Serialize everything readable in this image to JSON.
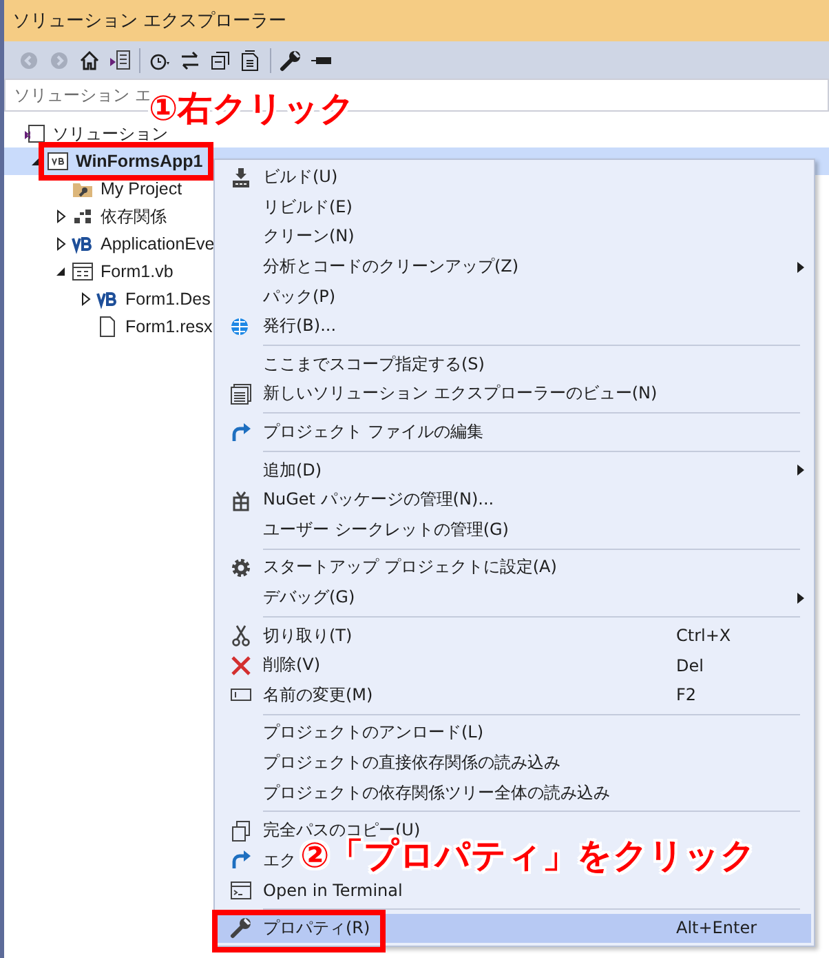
{
  "window": {
    "title": "ソリューション エクスプローラー"
  },
  "search": {
    "placeholder": "ソリューション エ"
  },
  "tree": [
    {
      "label": "ソリューション",
      "selected": false
    },
    {
      "label": "WinFormsApp1",
      "expanded": true,
      "selected": true,
      "children": [
        {
          "label": "My Project",
          "selected": false
        },
        {
          "label": "依存関係",
          "expanded": false,
          "selected": false
        },
        {
          "label": "ApplicationEve",
          "expanded": false,
          "selected": false
        },
        {
          "label": "Form1.vb",
          "expanded": true,
          "selected": false,
          "children": [
            {
              "label": "Form1.Des",
              "expanded": false,
              "selected": false
            },
            {
              "label": "Form1.resx",
              "selected": false
            }
          ]
        }
      ]
    }
  ],
  "context_menu": {
    "groups": [
      [
        {
          "label": "ビルド(U)",
          "submenu": false,
          "selected": false
        },
        {
          "label": "リビルド(E)",
          "submenu": false,
          "selected": false
        },
        {
          "label": "クリーン(N)",
          "submenu": false,
          "selected": false
        },
        {
          "label": "分析とコードのクリーンアップ(Z)",
          "submenu": true,
          "selected": false
        },
        {
          "label": "パック(P)",
          "submenu": false,
          "selected": false
        },
        {
          "label": "発行(B)...",
          "submenu": false,
          "selected": false
        }
      ],
      [
        {
          "label": "ここまでスコープ指定する(S)",
          "submenu": false,
          "selected": false
        },
        {
          "label": "新しいソリューション エクスプローラーのビュー(N)",
          "submenu": false,
          "selected": false
        }
      ],
      [
        {
          "label": "プロジェクト ファイルの編集",
          "submenu": false,
          "selected": false
        }
      ],
      [
        {
          "label": "追加(D)",
          "submenu": true,
          "selected": false
        },
        {
          "label": "NuGet パッケージの管理(N)...",
          "submenu": false,
          "selected": false
        },
        {
          "label": "ユーザー シークレットの管理(G)",
          "submenu": false,
          "selected": false
        }
      ],
      [
        {
          "label": "スタートアップ プロジェクトに設定(A)",
          "submenu": false,
          "selected": false
        },
        {
          "label": "デバッグ(G)",
          "submenu": true,
          "selected": false
        }
      ],
      [
        {
          "label": "切り取り(T)",
          "shortcut": "Ctrl+X",
          "submenu": false,
          "selected": false
        },
        {
          "label": "削除(V)",
          "shortcut": "Del",
          "submenu": false,
          "selected": false
        },
        {
          "label": "名前の変更(M)",
          "shortcut": "F2",
          "submenu": false,
          "selected": false
        }
      ],
      [
        {
          "label": "プロジェクトのアンロード(L)",
          "submenu": false,
          "selected": false
        },
        {
          "label": "プロジェクトの直接依存関係の読み込み",
          "submenu": false,
          "selected": false
        },
        {
          "label": "プロジェクトの依存関係ツリー全体の読み込み",
          "submenu": false,
          "selected": false
        }
      ],
      [
        {
          "label": "完全パスのコピー(U)",
          "submenu": false,
          "selected": false
        },
        {
          "label": "エク",
          "submenu": false,
          "selected": false
        },
        {
          "label": "Open in Terminal",
          "submenu": false,
          "selected": false
        }
      ],
      [
        {
          "label": "プロパティ(R)",
          "shortcut": "Alt+Enter",
          "submenu": false,
          "selected": true
        }
      ]
    ]
  },
  "annotations": [
    {
      "text": "①右クリック"
    },
    {
      "text": "②「プロパティ」をクリック"
    }
  ]
}
